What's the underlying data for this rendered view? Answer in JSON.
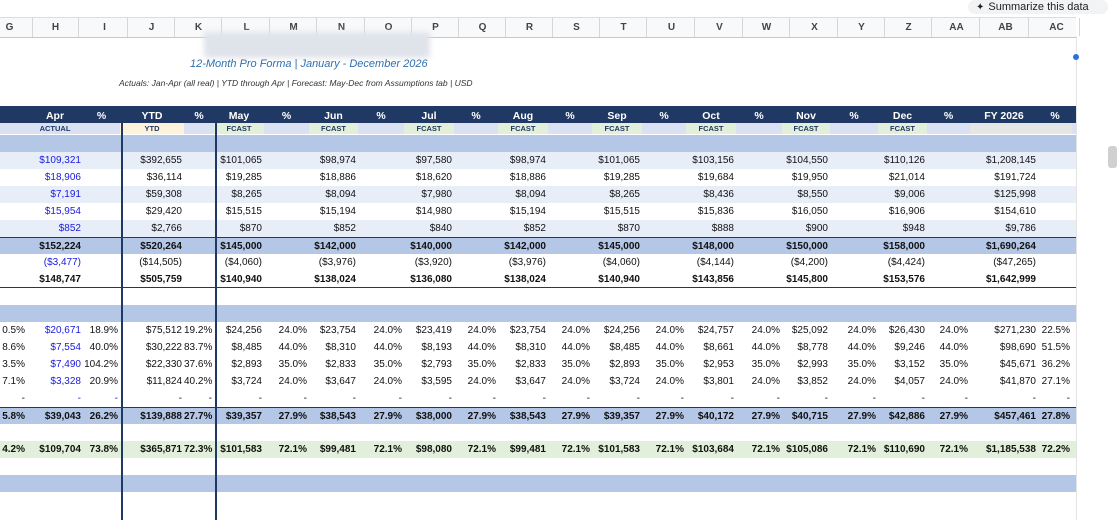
{
  "toolbar": {
    "summarize_label": "Summarize this data"
  },
  "column_letters": [
    "G",
    "H",
    "I",
    "J",
    "K",
    "L",
    "M",
    "N",
    "O",
    "P",
    "Q",
    "R",
    "S",
    "T",
    "U",
    "V",
    "W",
    "X",
    "Y",
    "Z",
    "AA",
    "AB",
    "AC"
  ],
  "title": "12-Month Pro Forma  |  January - December 2026",
  "subtitle": "Actuals: Jan-Apr (all real)  |  YTD through Apr  |  Forecast: May-Dec from Assumptions tab  |  USD",
  "header": [
    "%",
    "Apr",
    "%",
    "YTD",
    "%",
    "May",
    "%",
    "Jun",
    "%",
    "Jul",
    "%",
    "Aug",
    "%",
    "Sep",
    "%",
    "Oct",
    "%",
    "Nov",
    "%",
    "Dec",
    "%",
    "FY 2026",
    "%"
  ],
  "subheader": [
    "",
    "ACTUAL",
    "",
    "YTD",
    "",
    "FCAST",
    "",
    "FCAST",
    "",
    "FCAST",
    "",
    "FCAST",
    "",
    "FCAST",
    "",
    "FCAST",
    "",
    "FCAST",
    "",
    "FCAST",
    "",
    "",
    ""
  ],
  "rows": [
    {
      "style": "band",
      "cells": []
    },
    {
      "style": "light",
      "blue": [
        1
      ],
      "cells": [
        "",
        "$109,321",
        "",
        "$392,655",
        "",
        "$101,065",
        "",
        "$98,974",
        "",
        "$97,580",
        "",
        "$98,974",
        "",
        "$101,065",
        "",
        "$103,156",
        "",
        "$104,550",
        "",
        "$110,126",
        "",
        "$1,208,145",
        ""
      ]
    },
    {
      "style": "white",
      "blue": [
        1
      ],
      "cells": [
        "",
        "$18,906",
        "",
        "$36,114",
        "",
        "$19,285",
        "",
        "$18,886",
        "",
        "$18,620",
        "",
        "$18,886",
        "",
        "$19,285",
        "",
        "$19,684",
        "",
        "$19,950",
        "",
        "$21,014",
        "",
        "$191,724",
        ""
      ]
    },
    {
      "style": "light",
      "blue": [
        1
      ],
      "cells": [
        "",
        "$7,191",
        "",
        "$59,308",
        "",
        "$8,265",
        "",
        "$8,094",
        "",
        "$7,980",
        "",
        "$8,094",
        "",
        "$8,265",
        "",
        "$8,436",
        "",
        "$8,550",
        "",
        "$9,006",
        "",
        "$125,998",
        ""
      ]
    },
    {
      "style": "white",
      "blue": [
        1
      ],
      "cells": [
        "",
        "$15,954",
        "",
        "$29,420",
        "",
        "$15,515",
        "",
        "$15,194",
        "",
        "$14,980",
        "",
        "$15,194",
        "",
        "$15,515",
        "",
        "$15,836",
        "",
        "$16,050",
        "",
        "$16,906",
        "",
        "$154,610",
        ""
      ]
    },
    {
      "style": "light",
      "blue": [
        1
      ],
      "cells": [
        "",
        "$852",
        "",
        "$2,766",
        "",
        "$870",
        "",
        "$852",
        "",
        "$840",
        "",
        "$852",
        "",
        "$870",
        "",
        "$888",
        "",
        "$900",
        "",
        "$948",
        "",
        "$9,786",
        ""
      ]
    },
    {
      "style": "total",
      "cells": [
        "",
        "$152,224",
        "",
        "$520,264",
        "",
        "$145,000",
        "",
        "$142,000",
        "",
        "$140,000",
        "",
        "$142,000",
        "",
        "$145,000",
        "",
        "$148,000",
        "",
        "$150,000",
        "",
        "$158,000",
        "",
        "$1,690,264",
        ""
      ]
    },
    {
      "style": "white",
      "blue": [
        1
      ],
      "cells": [
        "",
        "($3,477)",
        "",
        "($14,505)",
        "",
        "($4,060)",
        "",
        "($3,976)",
        "",
        "($3,920)",
        "",
        "($3,976)",
        "",
        "($4,060)",
        "",
        "($4,144)",
        "",
        "($4,200)",
        "",
        "($4,424)",
        "",
        "($47,265)",
        ""
      ]
    },
    {
      "style": "net",
      "cells": [
        "",
        "$148,747",
        "",
        "$505,759",
        "",
        "$140,940",
        "",
        "$138,024",
        "",
        "$136,080",
        "",
        "$138,024",
        "",
        "$140,940",
        "",
        "$143,856",
        "",
        "$145,800",
        "",
        "$153,576",
        "",
        "$1,642,999",
        ""
      ]
    },
    {
      "style": "white",
      "cells": []
    },
    {
      "style": "band",
      "cells": []
    },
    {
      "style": "white",
      "blue": [
        1
      ],
      "cells": [
        "0.5%",
        "$20,671",
        "18.9%",
        "$75,512",
        "19.2%",
        "$24,256",
        "24.0%",
        "$23,754",
        "24.0%",
        "$23,419",
        "24.0%",
        "$23,754",
        "24.0%",
        "$24,256",
        "24.0%",
        "$24,757",
        "24.0%",
        "$25,092",
        "24.0%",
        "$26,430",
        "24.0%",
        "$271,230",
        "22.5%"
      ]
    },
    {
      "style": "white",
      "blue": [
        1
      ],
      "cells": [
        "8.6%",
        "$7,554",
        "40.0%",
        "$30,222",
        "83.7%",
        "$8,485",
        "44.0%",
        "$8,310",
        "44.0%",
        "$8,193",
        "44.0%",
        "$8,310",
        "44.0%",
        "$8,485",
        "44.0%",
        "$8,661",
        "44.0%",
        "$8,778",
        "44.0%",
        "$9,246",
        "44.0%",
        "$98,690",
        "51.5%"
      ]
    },
    {
      "style": "white",
      "blue": [
        1
      ],
      "cells": [
        "3.5%",
        "$7,490",
        "104.2%",
        "$22,330",
        "37.6%",
        "$2,893",
        "35.0%",
        "$2,833",
        "35.0%",
        "$2,793",
        "35.0%",
        "$2,833",
        "35.0%",
        "$2,893",
        "35.0%",
        "$2,953",
        "35.0%",
        "$2,993",
        "35.0%",
        "$3,152",
        "35.0%",
        "$45,671",
        "36.2%"
      ]
    },
    {
      "style": "white",
      "blue": [
        1
      ],
      "cells": [
        "7.1%",
        "$3,328",
        "20.9%",
        "$11,824",
        "40.2%",
        "$3,724",
        "24.0%",
        "$3,647",
        "24.0%",
        "$3,595",
        "24.0%",
        "$3,647",
        "24.0%",
        "$3,724",
        "24.0%",
        "$3,801",
        "24.0%",
        "$3,852",
        "24.0%",
        "$4,057",
        "24.0%",
        "$41,870",
        "27.1%"
      ]
    },
    {
      "style": "white",
      "blue": [
        1,
        2
      ],
      "cells": [
        "-",
        "-",
        "-",
        "-",
        "-",
        "-",
        "-",
        "-",
        "-",
        "-",
        "-",
        "-",
        "-",
        "-",
        "-",
        "-",
        "-",
        "-",
        "-",
        "-",
        "-",
        "-",
        "-"
      ]
    },
    {
      "style": "total",
      "cells": [
        "5.8%",
        "$39,043",
        "26.2%",
        "$139,888",
        "27.7%",
        "$39,357",
        "27.9%",
        "$38,543",
        "27.9%",
        "$38,000",
        "27.9%",
        "$38,543",
        "27.9%",
        "$39,357",
        "27.9%",
        "$40,172",
        "27.9%",
        "$40,715",
        "27.9%",
        "$42,886",
        "27.9%",
        "$457,461",
        "27.8%"
      ]
    },
    {
      "style": "white",
      "cells": []
    },
    {
      "style": "greenrow",
      "cells": [
        "4.2%",
        "$109,704",
        "73.8%",
        "$365,871",
        "72.3%",
        "$101,583",
        "72.1%",
        "$99,481",
        "72.1%",
        "$98,080",
        "72.1%",
        "$99,481",
        "72.1%",
        "$101,583",
        "72.1%",
        "$103,684",
        "72.1%",
        "$105,086",
        "72.1%",
        "$110,690",
        "72.1%",
        "$1,185,538",
        "72.2%"
      ]
    },
    {
      "style": "white",
      "cells": []
    },
    {
      "style": "band",
      "cells": []
    },
    {
      "style": "white",
      "cells": []
    }
  ]
}
